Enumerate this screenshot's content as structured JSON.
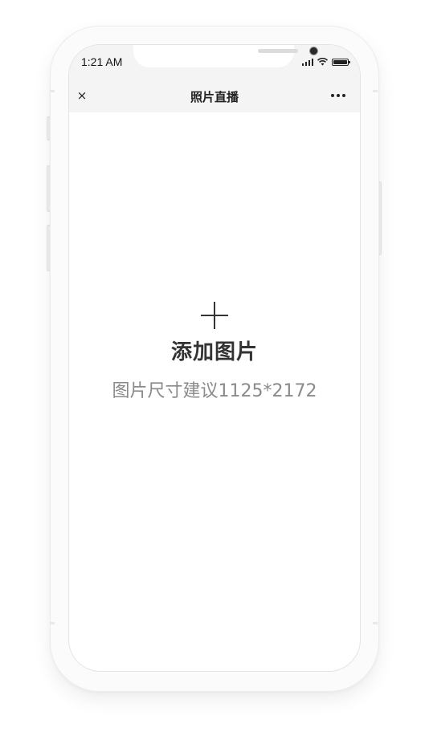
{
  "status_bar": {
    "time": "1:21 AM",
    "icons": [
      "signal-icon",
      "wifi-icon",
      "battery-icon"
    ]
  },
  "nav": {
    "close_icon": "×",
    "title": "照片直播",
    "more_icon": "more-icon"
  },
  "content": {
    "add_icon": "plus-icon",
    "add_label": "添加图片",
    "size_hint": "图片尺寸建议1125*2172"
  },
  "colors": {
    "text_primary": "#333333",
    "text_secondary": "#8a8a8a",
    "status_bg": "#f4f4f4"
  }
}
